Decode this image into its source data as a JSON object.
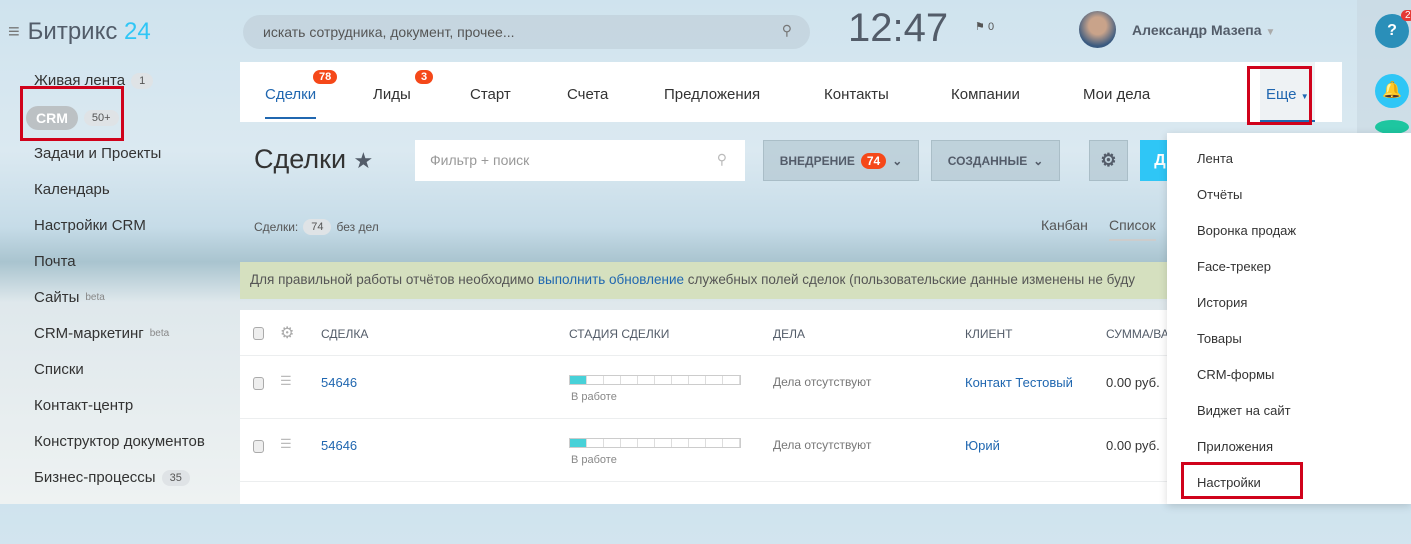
{
  "logo": {
    "text": "Битрикс",
    "num": "24"
  },
  "sidebar": {
    "items": [
      {
        "label": "Живая лента",
        "count": "1"
      },
      {
        "label": "CRM",
        "count": "50+"
      },
      {
        "label": "Задачи и Проекты"
      },
      {
        "label": "Календарь"
      },
      {
        "label": "Настройки CRM"
      },
      {
        "label": "Почта"
      },
      {
        "label": "Сайты",
        "sup": "beta"
      },
      {
        "label": "CRM-маркетинг",
        "sup": "beta"
      },
      {
        "label": "Списки"
      },
      {
        "label": "Контакт-центр"
      },
      {
        "label": "Конструктор документов"
      },
      {
        "label": "Бизнес-процессы",
        "count": "35"
      }
    ]
  },
  "header": {
    "search_placeholder": "искать сотрудника, документ, прочее...",
    "clock": "12:47",
    "flag_count": "0",
    "user": "Александр Мазепа",
    "help_badge": "2"
  },
  "tabs": [
    {
      "label": "Сделки",
      "badge": "78"
    },
    {
      "label": "Лиды",
      "badge": "3"
    },
    {
      "label": "Старт"
    },
    {
      "label": "Счета"
    },
    {
      "label": "Предложения"
    },
    {
      "label": "Контакты"
    },
    {
      "label": "Компании"
    },
    {
      "label": "Мои дела"
    },
    {
      "label": "Еще"
    }
  ],
  "page": {
    "title": "Сделки",
    "filter_placeholder": "Фильтр + поиск",
    "btn_vnedrenie": "ВНЕДРЕНИЕ",
    "btn_vnedrenie_count": "74",
    "btn_sozdannye": "СОЗДАННЫЕ",
    "btn_add": "Д",
    "stats_label": "Сделки:",
    "stats_count": "74",
    "stats_suffix": "без дел",
    "view_kanban": "Канбан",
    "view_list": "Список"
  },
  "banner": {
    "before": "Для правильной работы отчётов необходимо ",
    "link": "выполнить обновление",
    "after": " служебных полей сделок (пользовательские данные изменены не буду"
  },
  "table": {
    "headers": [
      "СДЕЛКА",
      "СТАДИЯ СДЕЛКИ",
      "ДЕЛА",
      "КЛИЕНТ",
      "СУММА/ВА"
    ],
    "rows": [
      {
        "deal": "54646",
        "stage": "В работе",
        "stage_progress": 0.1,
        "tasks": "Дела отсутствуют",
        "client": "Контакт Тестовый",
        "sum": "0.00 руб."
      },
      {
        "deal": "54646",
        "stage": "В работе",
        "stage_progress": 0.1,
        "tasks": "Дела отсутствуют",
        "client": "Юрий",
        "sum": "0.00 руб."
      }
    ]
  },
  "more_menu": [
    "Лента",
    "Отчёты",
    "Воронка продаж",
    "Face-трекер",
    "История",
    "Товары",
    "CRM-формы",
    "Виджет на сайт",
    "Приложения",
    "Настройки"
  ]
}
